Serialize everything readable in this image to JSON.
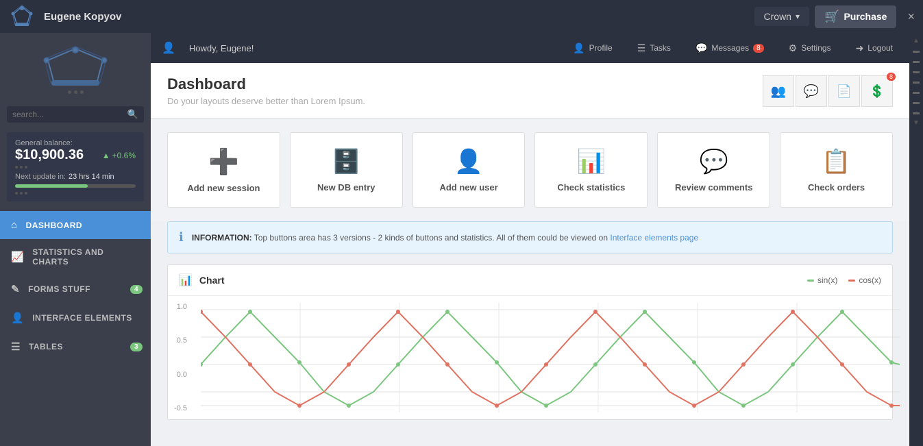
{
  "topnav": {
    "username": "Eugene Kopyov",
    "crown_label": "Crown",
    "purchase_label": "Purchase",
    "close_label": "×"
  },
  "header_bar": {
    "greeting": "Howdy, Eugene!",
    "profile_label": "Profile",
    "tasks_label": "Tasks",
    "messages_label": "Messages",
    "messages_count": "8",
    "settings_label": "Settings",
    "logout_label": "Logout"
  },
  "dashboard": {
    "title": "Dashboard",
    "subtitle": "Do your layouts deserve better than Lorem Ipsum."
  },
  "quick_buttons": [
    {
      "label": "Add new session",
      "icon": "➕"
    },
    {
      "label": "New DB entry",
      "icon": "🗄️"
    },
    {
      "label": "Add new user",
      "icon": "👤"
    },
    {
      "label": "Check statistics",
      "icon": "📊"
    },
    {
      "label": "Review comments",
      "icon": "💬"
    },
    {
      "label": "Check orders",
      "icon": "📋"
    }
  ],
  "info": {
    "prefix": "INFORMATION:",
    "text": "Top buttons area has 3 versions - 2 kinds of buttons and statistics. All of them could be viewed on",
    "link_text": "Interface elements page"
  },
  "chart": {
    "title": "Chart",
    "legend_sin": "sin(x)",
    "legend_cos": "cos(x)",
    "y_labels": [
      "1.0",
      "0.5",
      "0.0",
      "-0.5"
    ]
  },
  "sidebar": {
    "search_placeholder": "search...",
    "balance_label": "General balance:",
    "balance_amount": "$10,900.36",
    "balance_change": "+0.6%",
    "next_update_label": "Next update in:",
    "next_update_value": "23 hrs  14 min",
    "nav_items": [
      {
        "label": "Dashboard",
        "icon": "⌂",
        "active": true,
        "badge": ""
      },
      {
        "label": "Statistics and Charts",
        "icon": "📈",
        "active": false,
        "badge": ""
      },
      {
        "label": "Forms Stuff",
        "icon": "✎",
        "active": false,
        "badge": "4"
      },
      {
        "label": "Interface Elements",
        "icon": "👤",
        "active": false,
        "badge": ""
      },
      {
        "label": "Tables",
        "icon": "☰",
        "active": false,
        "badge": "3"
      }
    ]
  },
  "colors": {
    "accent_blue": "#4a90d9",
    "accent_green": "#7bc67e",
    "accent_red": "#e74c3c"
  }
}
